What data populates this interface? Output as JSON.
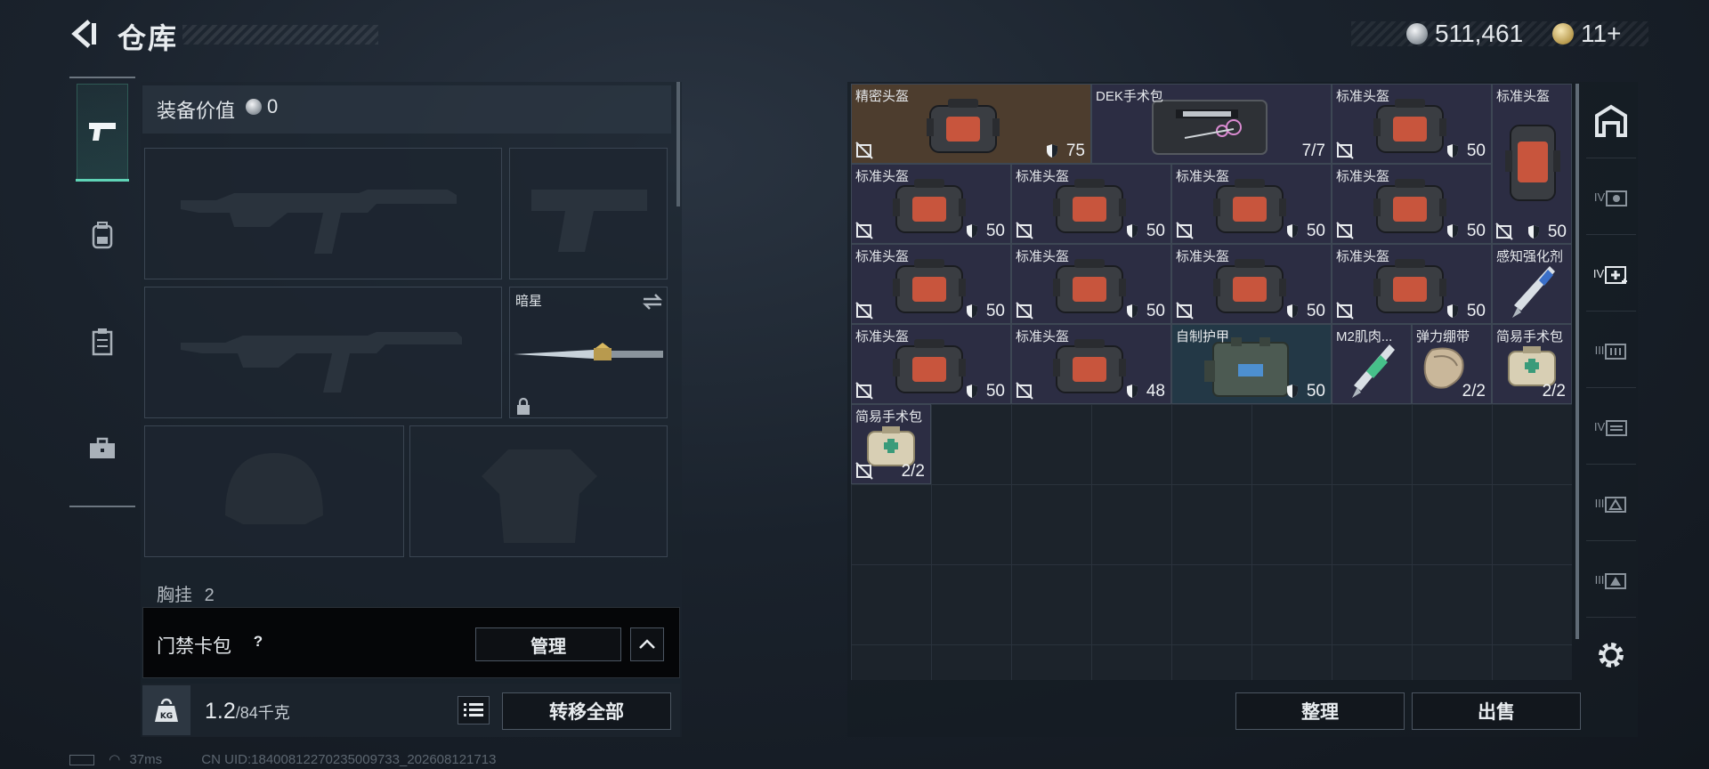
{
  "header": {
    "title": "仓库",
    "currency_silver": "511,461",
    "currency_gold": "11+"
  },
  "loadout": {
    "gear_value_label": "装备价值",
    "gear_value": "0",
    "melee_label": "暗星",
    "chest_label": "胸挂",
    "chest_count": "2",
    "keycard_label": "门禁卡包",
    "keycard_help": "?",
    "manage_label": "管理",
    "weight_value": "1.2",
    "weight_max": "/84千克",
    "transfer_all_label": "转移全部"
  },
  "status": {
    "ping": "37ms",
    "uid": "CN UID:18400812270235009733_202608121713"
  },
  "storage": {
    "items": [
      {
        "name": "精密头盔",
        "value": "75"
      },
      {
        "name": "DEK手术包",
        "value": "7/7"
      },
      {
        "name": "标准头盔",
        "value": "50"
      },
      {
        "name": "标准头盔",
        "value": ""
      },
      {
        "name": "标准头盔",
        "value": "50"
      },
      {
        "name": "标准头盔",
        "value": "50"
      },
      {
        "name": "标准头盔",
        "value": "50"
      },
      {
        "name": "标准头盔",
        "value": "50"
      },
      {
        "name": "",
        "value": "50"
      },
      {
        "name": "标准头盔",
        "value": "50"
      },
      {
        "name": "标准头盔",
        "value": "50"
      },
      {
        "name": "标准头盔",
        "value": "50"
      },
      {
        "name": "标准头盔",
        "value": "50"
      },
      {
        "name": "感知强化剂",
        "value": ""
      },
      {
        "name": "标准头盔",
        "value": "50"
      },
      {
        "name": "标准头盔",
        "value": "48"
      },
      {
        "name": "自制护甲",
        "value": "50"
      },
      {
        "name": "M2肌肉...",
        "value": ""
      },
      {
        "name": "弹力绷带",
        "value": "2/2"
      },
      {
        "name": "简易手术包",
        "value": "2/2"
      },
      {
        "name": "简易手术包",
        "value": "2/2"
      }
    ],
    "sort_label": "整理",
    "sell_label": "出售"
  },
  "right_nav": {
    "labels": [
      "IV",
      "IV",
      "III",
      "IV",
      "III",
      "III"
    ]
  },
  "colors": {
    "accent_teal": "#5fd3b6",
    "item_gold_bg": "#4d3d2e",
    "item_purple_bg": "#2c2d43"
  }
}
